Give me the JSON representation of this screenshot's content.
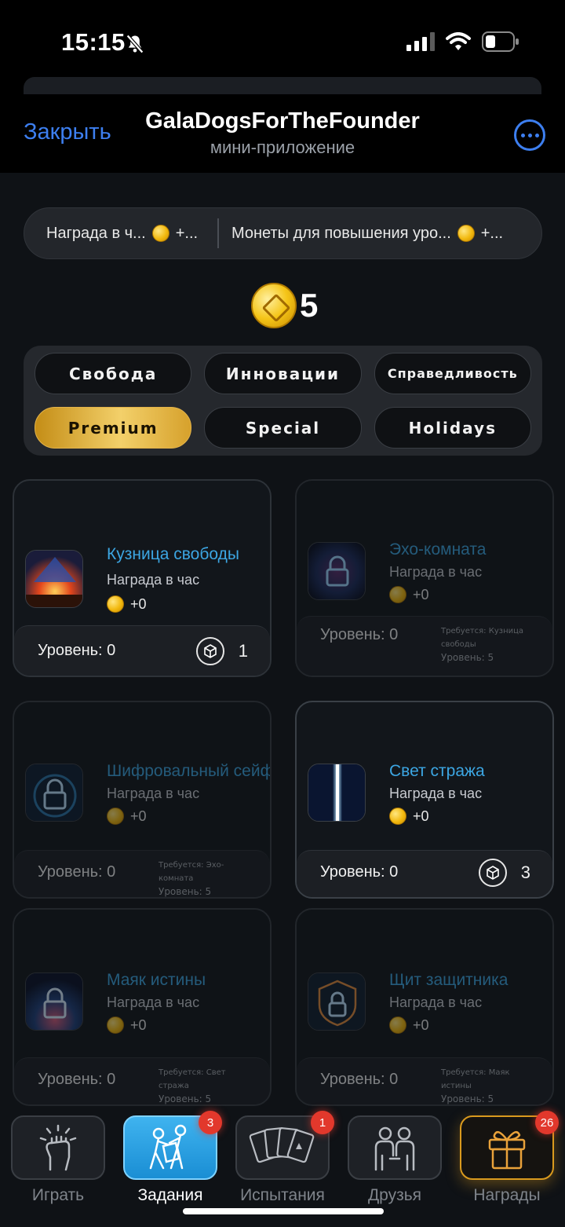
{
  "status_bar": {
    "time": "15:15"
  },
  "header": {
    "close_label": "Закрыть",
    "title": "GalaDogsForTheFounder",
    "subtitle": "мини-приложение"
  },
  "info": {
    "hourly_label": "Награда в ч...",
    "hourly_value": "+...",
    "upgrade_label": "Монеты для повышения уро...",
    "upgrade_value": "+..."
  },
  "balance": "5",
  "tabs": [
    {
      "label": "Свобода",
      "active": false
    },
    {
      "label": "Инновации",
      "active": false
    },
    {
      "label": "Справедливость",
      "active": false
    },
    {
      "label": "Premium",
      "active": true
    },
    {
      "label": "Special",
      "active": false
    },
    {
      "label": "Holidays",
      "active": false
    }
  ],
  "cards": [
    {
      "title": "Кузница свободы",
      "subtitle": "Награда в час",
      "reward": "+0",
      "level_label": "Уровень: 0",
      "cost": "1",
      "locked": false
    },
    {
      "title": "Эхо-комната",
      "subtitle": "Награда в час",
      "reward": "+0",
      "level_label": "Уровень: 0",
      "requirement": "Требуется: Кузница свободы",
      "requirement_level": "Уровень: 5",
      "locked": true
    },
    {
      "title": "Шифровальный сейф",
      "subtitle": "Награда в час",
      "reward": "+0",
      "level_label": "Уровень: 0",
      "requirement": "Требуется: Эхо-комната",
      "requirement_level": "Уровень: 5",
      "locked": true
    },
    {
      "title": "Свет стража",
      "subtitle": "Награда в час",
      "reward": "+0",
      "level_label": "Уровень: 0",
      "cost": "3",
      "locked": false
    },
    {
      "title": "Маяк истины",
      "subtitle": "Награда в час",
      "reward": "+0",
      "level_label": "Уровень: 0",
      "requirement": "Требуется: Свет стража",
      "requirement_level": "Уровень: 5",
      "locked": true
    },
    {
      "title": "Щит защитника",
      "subtitle": "Награда в час",
      "reward": "+0",
      "level_label": "Уровень: 0",
      "requirement": "Требуется: Маяк истины",
      "requirement_level": "Уровень: 5",
      "locked": true
    }
  ],
  "nav": [
    {
      "label": "Играть",
      "icon": "fist-icon",
      "badge": ""
    },
    {
      "label": "Задания",
      "icon": "tasks-icon",
      "badge": "3"
    },
    {
      "label": "Испытания",
      "icon": "cards-icon",
      "badge": "1"
    },
    {
      "label": "Друзья",
      "icon": "friends-icon",
      "badge": ""
    },
    {
      "label": "Награды",
      "icon": "gift-icon",
      "badge": "26"
    }
  ],
  "colors": {
    "accent": "#3d7ff0",
    "title_blue": "#3ca6e3",
    "gold": "#f3c33b",
    "badge_red": "#e2382c"
  }
}
